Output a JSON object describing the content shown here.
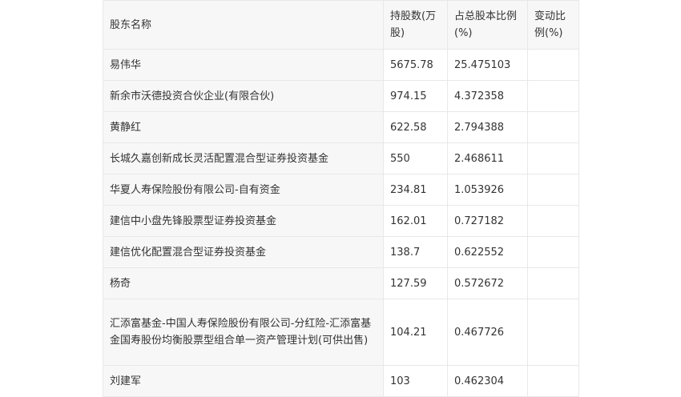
{
  "table": {
    "headers": [
      "股东名称",
      "持股数(万股)",
      "占总股本比例(%)",
      "变动比例(%)"
    ],
    "rows": [
      {
        "name": "易伟华",
        "shares": "5675.78",
        "ratio": "25.475103",
        "change": ""
      },
      {
        "name": "新余市沃德投资合伙企业(有限合伙)",
        "shares": "974.15",
        "ratio": "4.372358",
        "change": ""
      },
      {
        "name": "黄静红",
        "shares": "622.58",
        "ratio": "2.794388",
        "change": ""
      },
      {
        "name": "长城久嘉创新成长灵活配置混合型证券投资基金",
        "shares": "550",
        "ratio": "2.468611",
        "change": ""
      },
      {
        "name": "华夏人寿保险股份有限公司-自有资金",
        "shares": "234.81",
        "ratio": "1.053926",
        "change": ""
      },
      {
        "name": "建信中小盘先锋股票型证券投资基金",
        "shares": "162.01",
        "ratio": "0.727182",
        "change": ""
      },
      {
        "name": "建信优化配置混合型证券投资基金",
        "shares": "138.7",
        "ratio": "0.622552",
        "change": ""
      },
      {
        "name": "杨奇",
        "shares": "127.59",
        "ratio": "0.572672",
        "change": ""
      },
      {
        "name": "汇添富基金-中国人寿保险股份有限公司-分红险-汇添富基金国寿股份均衡股票型组合单一资产管理计划(可供出售)",
        "shares": "104.21",
        "ratio": "0.467726",
        "change": ""
      },
      {
        "name": "刘建军",
        "shares": "103",
        "ratio": "0.462304",
        "change": ""
      }
    ]
  }
}
